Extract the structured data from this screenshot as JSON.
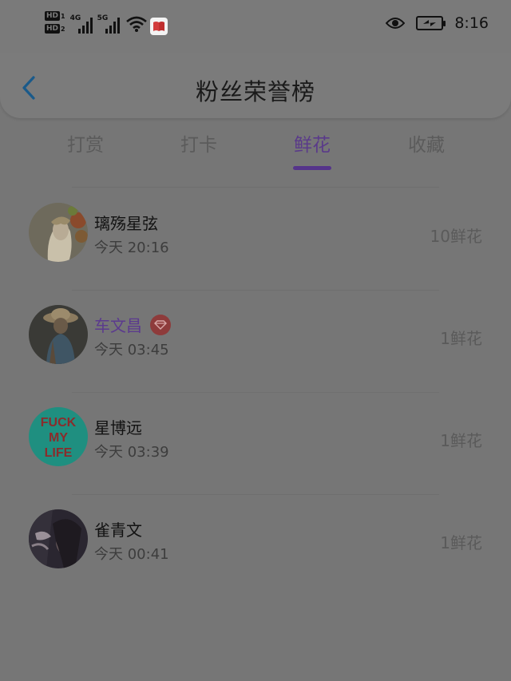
{
  "status_bar": {
    "sim1_label": "HD",
    "sim1_slot": "1",
    "sim2_label": "HD",
    "sim2_slot": "2",
    "net1": "4G",
    "net2": "5G",
    "time": "8:16",
    "icons": [
      "hd-icon",
      "signal-icon",
      "wifi-icon",
      "reader-app-icon",
      "eye-icon",
      "battery-saver-icon"
    ]
  },
  "header": {
    "title": "粉丝荣誉榜",
    "back_icon": "chevron-left-icon"
  },
  "tabs": [
    {
      "label": "打赏",
      "active": false
    },
    {
      "label": "打卡",
      "active": false
    },
    {
      "label": "鲜花",
      "active": true
    },
    {
      "label": "收藏",
      "active": false
    }
  ],
  "list": [
    {
      "name": "璃殇星弦",
      "time": "今天 20:16",
      "amount": "10鲜花",
      "vip": false,
      "avatar": "avatar-woman-flowers"
    },
    {
      "name": "车文昌",
      "time": "今天 03:45",
      "amount": "1鲜花",
      "vip": true,
      "avatar": "avatar-woman-hat"
    },
    {
      "name": "星博远",
      "time": "今天 03:39",
      "amount": "1鲜花",
      "vip": false,
      "avatar": "avatar-text",
      "avatar_text": [
        "FUCK",
        "MY",
        "LIFE"
      ]
    },
    {
      "name": "雀青文",
      "time": "今天 00:41",
      "amount": "1鲜花",
      "vip": false,
      "avatar": "avatar-smoke"
    }
  ],
  "colors": {
    "background": "#767676",
    "accent": "#55348a",
    "vip_badge": "#8e3b3b",
    "avatar_teal": "#1f8f80"
  }
}
